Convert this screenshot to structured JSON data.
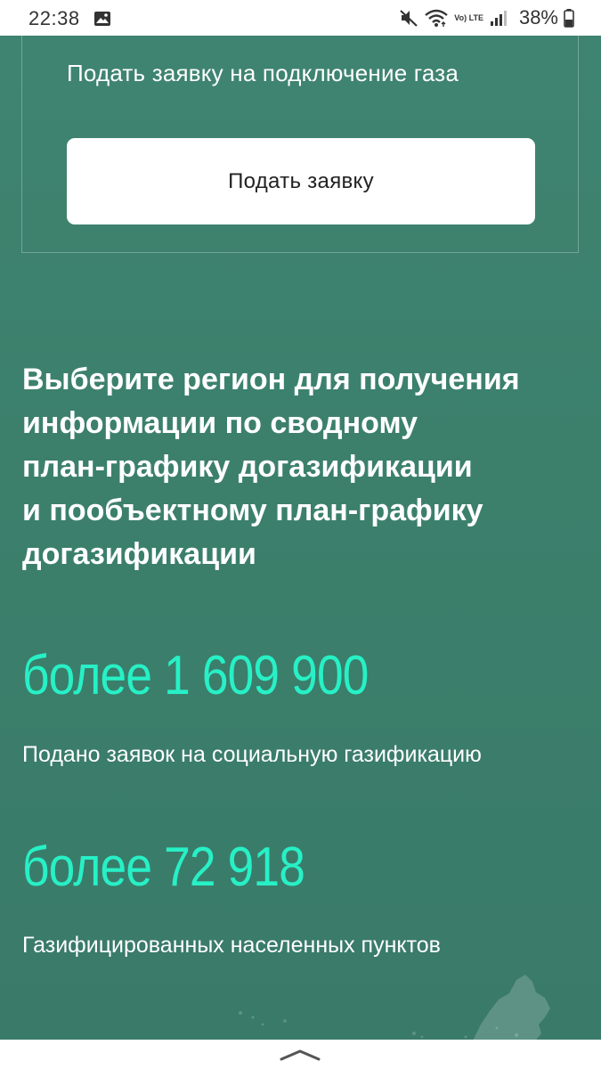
{
  "status_bar": {
    "time": "22:38",
    "lte_label": "Vo) LTE",
    "battery_percent": "38%",
    "icons": [
      "gallery-icon",
      "mute-icon",
      "wifi-icon",
      "lte-icon",
      "signal-icon",
      "battery-icon"
    ]
  },
  "card": {
    "title": "Подать заявку на подключение газа",
    "button_label": "Подать заявку"
  },
  "region": {
    "heading_lines": [
      "Выберите регион для получения",
      "информации по сводному",
      "план-графику догазификации",
      "и пообъектному план-графику",
      "догазификации"
    ]
  },
  "stats": [
    {
      "value": "более 1 609 900",
      "caption": "Подано заявок на социальную газификацию"
    },
    {
      "value": "более 72 918",
      "caption": "Газифицированных населенных пунктов"
    }
  ],
  "colors": {
    "background": "#3d8270",
    "accent": "#27f0c6",
    "button_bg": "#ffffff",
    "text": "#ffffff"
  }
}
